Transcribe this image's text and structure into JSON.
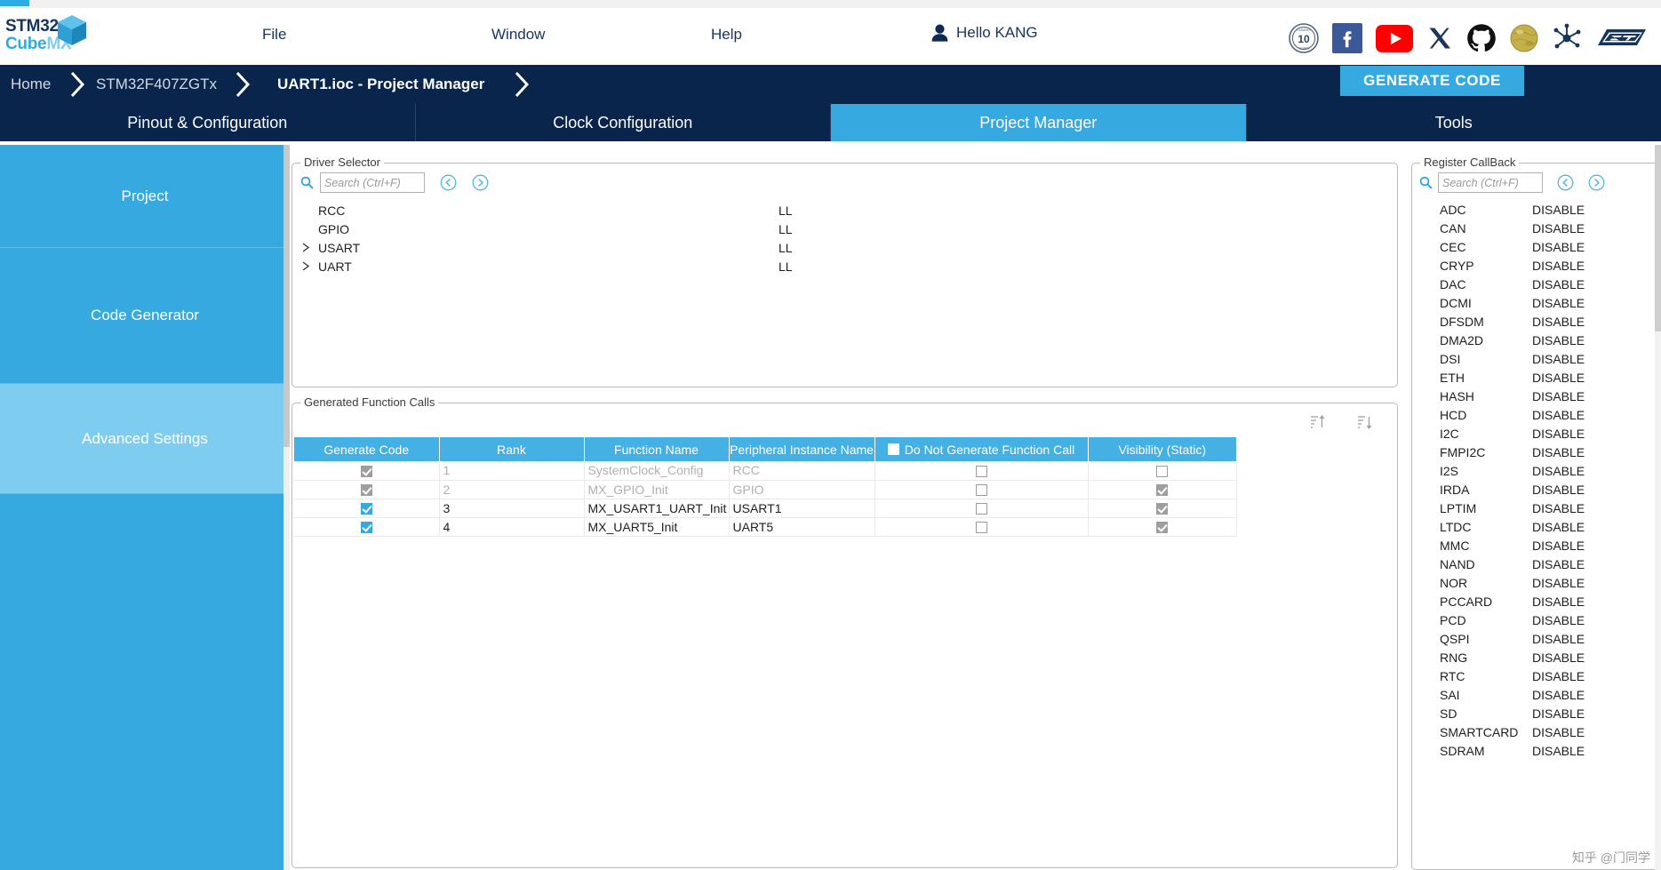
{
  "app": {
    "logo_line1": "STM32",
    "logo_line2_a": "Cube",
    "logo_line2_b": "MX"
  },
  "menubar": {
    "items": [
      {
        "label": "File"
      },
      {
        "label": "Window"
      },
      {
        "label": "Help"
      }
    ],
    "user_greeting": "Hello KANG",
    "social_icons": [
      "ten-years-badge-icon",
      "facebook-icon",
      "youtube-icon",
      "x-twitter-icon",
      "github-icon",
      "wikipedia-icon",
      "community-hub-icon",
      "st-logo-icon"
    ]
  },
  "breadcrumb": {
    "items": [
      {
        "label": "Home",
        "active": false
      },
      {
        "label": "STM32F407ZGTx",
        "active": false
      },
      {
        "label": "UART1.ioc - Project Manager",
        "active": true
      }
    ],
    "generate_code_label": "GENERATE CODE"
  },
  "main_tabs": [
    {
      "label": "Pinout & Configuration",
      "selected": false
    },
    {
      "label": "Clock Configuration",
      "selected": false
    },
    {
      "label": "Project Manager",
      "selected": true
    },
    {
      "label": "Tools",
      "selected": false
    }
  ],
  "sidebar": {
    "items": [
      {
        "label": "Project",
        "active": false
      },
      {
        "label": "Code Generator",
        "active": false
      },
      {
        "label": "Advanced Settings",
        "active": true
      }
    ]
  },
  "driver_selector": {
    "title": "Driver Selector",
    "search_placeholder": "Search (Ctrl+F)",
    "search_value": "",
    "prev_label": "collapse-all",
    "next_label": "expand-all",
    "rows": [
      {
        "name": "RCC",
        "type": "LL",
        "expandable": false
      },
      {
        "name": "GPIO",
        "type": "LL",
        "expandable": false
      },
      {
        "name": "USART",
        "type": "LL",
        "expandable": true
      },
      {
        "name": "UART",
        "type": "LL",
        "expandable": true
      }
    ]
  },
  "generated_function_calls": {
    "title": "Generated Function Calls",
    "sort_asc_label": "sort-ascending",
    "sort_desc_label": "sort-descending",
    "columns": [
      "Generate Code",
      "Rank",
      "Function Name",
      "Peripheral Instance Name",
      "Do Not Generate Function Call",
      "Visibility (Static)"
    ],
    "header_checkbox_checked": false,
    "rows": [
      {
        "generate_code": true,
        "generate_code_disabled": true,
        "rank": "1",
        "function_name": "SystemClock_Config",
        "peripheral_instance_name": "RCC",
        "do_not_generate": false,
        "do_not_generate_disabled": true,
        "visibility_static": false,
        "visibility_disabled": true,
        "disabled": true
      },
      {
        "generate_code": true,
        "generate_code_disabled": true,
        "rank": "2",
        "function_name": "MX_GPIO_Init",
        "peripheral_instance_name": "GPIO",
        "do_not_generate": false,
        "do_not_generate_disabled": true,
        "visibility_static": true,
        "visibility_disabled": true,
        "disabled": true
      },
      {
        "generate_code": true,
        "generate_code_disabled": false,
        "rank": "3",
        "function_name": "MX_USART1_UART_Init",
        "peripheral_instance_name": "USART1",
        "do_not_generate": false,
        "do_not_generate_disabled": false,
        "visibility_static": true,
        "visibility_disabled": true,
        "disabled": false
      },
      {
        "generate_code": true,
        "generate_code_disabled": false,
        "rank": "4",
        "function_name": "MX_UART5_Init",
        "peripheral_instance_name": "UART5",
        "do_not_generate": false,
        "do_not_generate_disabled": false,
        "visibility_static": true,
        "visibility_disabled": true,
        "disabled": false
      }
    ]
  },
  "register_callback": {
    "title": "Register CallBack",
    "search_placeholder": "Search (Ctrl+F)",
    "search_value": "",
    "rows": [
      {
        "name": "ADC",
        "value": "DISABLE"
      },
      {
        "name": "CAN",
        "value": "DISABLE"
      },
      {
        "name": "CEC",
        "value": "DISABLE"
      },
      {
        "name": "CRYP",
        "value": "DISABLE"
      },
      {
        "name": "DAC",
        "value": "DISABLE"
      },
      {
        "name": "DCMI",
        "value": "DISABLE"
      },
      {
        "name": "DFSDM",
        "value": "DISABLE"
      },
      {
        "name": "DMA2D",
        "value": "DISABLE"
      },
      {
        "name": "DSI",
        "value": "DISABLE"
      },
      {
        "name": "ETH",
        "value": "DISABLE"
      },
      {
        "name": "HASH",
        "value": "DISABLE"
      },
      {
        "name": "HCD",
        "value": "DISABLE"
      },
      {
        "name": "I2C",
        "value": "DISABLE"
      },
      {
        "name": "FMPI2C",
        "value": "DISABLE"
      },
      {
        "name": "I2S",
        "value": "DISABLE"
      },
      {
        "name": "IRDA",
        "value": "DISABLE"
      },
      {
        "name": "LPTIM",
        "value": "DISABLE"
      },
      {
        "name": "LTDC",
        "value": "DISABLE"
      },
      {
        "name": "MMC",
        "value": "DISABLE"
      },
      {
        "name": "NAND",
        "value": "DISABLE"
      },
      {
        "name": "NOR",
        "value": "DISABLE"
      },
      {
        "name": "PCCARD",
        "value": "DISABLE"
      },
      {
        "name": "PCD",
        "value": "DISABLE"
      },
      {
        "name": "QSPI",
        "value": "DISABLE"
      },
      {
        "name": "RNG",
        "value": "DISABLE"
      },
      {
        "name": "RTC",
        "value": "DISABLE"
      },
      {
        "name": "SAI",
        "value": "DISABLE"
      },
      {
        "name": "SD",
        "value": "DISABLE"
      },
      {
        "name": "SMARTCARD",
        "value": "DISABLE"
      },
      {
        "name": "SDRAM",
        "value": "DISABLE"
      }
    ]
  },
  "watermark": {
    "text": "知乎 @门同学"
  },
  "colors": {
    "brand_blue": "#36a9e1",
    "dark_navy": "#09254b",
    "table_header": "#45b0e3",
    "sidebar_active": "#7ecdf0"
  }
}
